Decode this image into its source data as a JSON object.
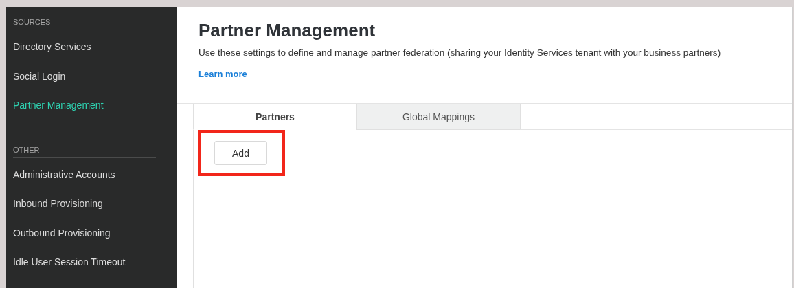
{
  "sidebar": {
    "sections": [
      {
        "heading": "SOURCES",
        "items": [
          {
            "label": "Directory Services",
            "selected": false
          },
          {
            "label": "Social Login",
            "selected": false
          },
          {
            "label": "Partner Management",
            "selected": true
          }
        ]
      },
      {
        "heading": "OTHER",
        "items": [
          {
            "label": "Administrative Accounts",
            "selected": false
          },
          {
            "label": "Inbound Provisioning",
            "selected": false
          },
          {
            "label": "Outbound Provisioning",
            "selected": false
          },
          {
            "label": "Idle User Session Timeout",
            "selected": false
          }
        ]
      }
    ]
  },
  "page": {
    "title": "Partner Management",
    "description": "Use these settings to define and manage partner federation (sharing your Identity Services tenant with your business partners)",
    "link": "Learn more"
  },
  "tabs": [
    {
      "label": "Partners",
      "selected": true
    },
    {
      "label": "Global Mappings",
      "selected": false
    }
  ],
  "add_button": {
    "label": "Add",
    "highlighted": true
  }
}
